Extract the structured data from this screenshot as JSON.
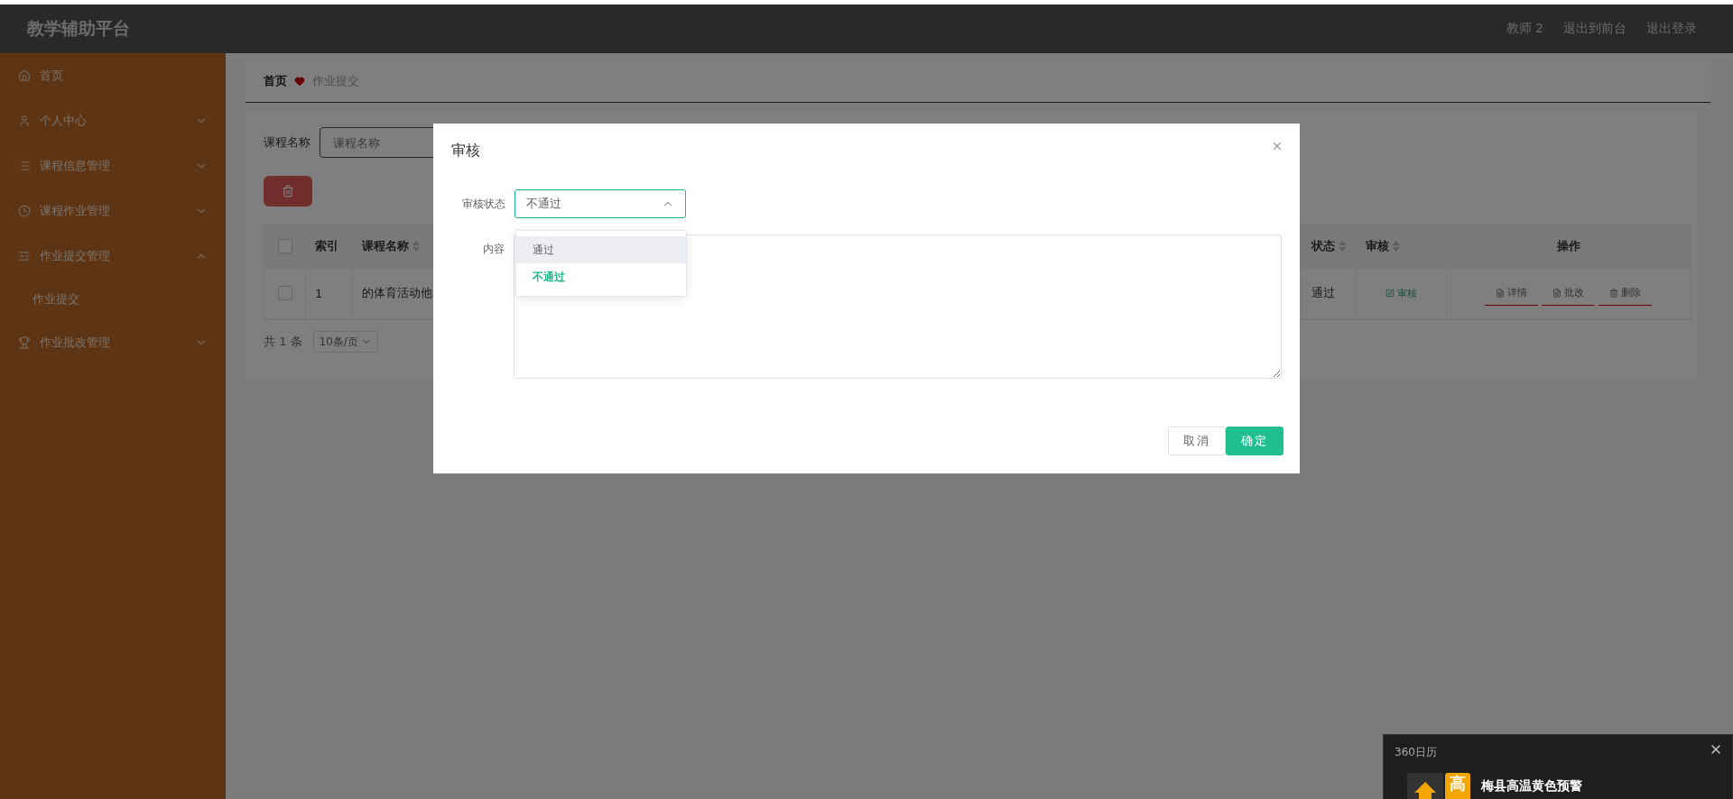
{
  "header": {
    "title": "教学辅助平台",
    "links": [
      "教师 2",
      "退出到前台",
      "退出登录"
    ]
  },
  "sidebar": {
    "items": [
      {
        "label": "首页",
        "kind": "link"
      },
      {
        "label": "个人中心",
        "kind": "menu",
        "expanded": false
      },
      {
        "label": "课程信息管理",
        "kind": "menu",
        "expanded": false
      },
      {
        "label": "课程作业管理",
        "kind": "menu",
        "expanded": false
      },
      {
        "label": "作业提交管理",
        "kind": "menu",
        "expanded": true,
        "children": [
          {
            "label": "作业提交"
          }
        ]
      },
      {
        "label": "作业批改管理",
        "kind": "menu",
        "expanded": false
      }
    ]
  },
  "breadcrumb": [
    "首页",
    "作业提交"
  ],
  "search": {
    "label": "课程名称",
    "placeholder": "课程名称"
  },
  "table": {
    "all_checked": false,
    "columns": [
      {
        "label": "索引",
        "sortable": false
      },
      {
        "label": "课程名称",
        "sortable": true
      },
      {
        "label": "状态",
        "sortable": true
      },
      {
        "label": "审核",
        "sortable": true
      },
      {
        "label": "操作",
        "sortable": false
      }
    ],
    "rows": [
      {
        "checked": false,
        "index": "1",
        "course": "的体育活动他",
        "status": "通过",
        "review": "审核",
        "actions": [
          "详情",
          "批改",
          "删除"
        ]
      }
    ]
  },
  "pagination": {
    "total": "共 1 条",
    "page_size": "10条/页"
  },
  "modal": {
    "title": "审核",
    "status_label": "审核状态",
    "status_value": "不通过",
    "dropdown_open": true,
    "options": [
      {
        "label": "通过",
        "selected": false,
        "hovered": true
      },
      {
        "label": "不通过",
        "selected": true,
        "hovered": false
      }
    ],
    "content_label": "内容",
    "buttons": [
      "取消",
      "确定"
    ]
  },
  "notification": {
    "app": "360日历",
    "badge": "高",
    "title": "梅县高温黄色预警"
  }
}
